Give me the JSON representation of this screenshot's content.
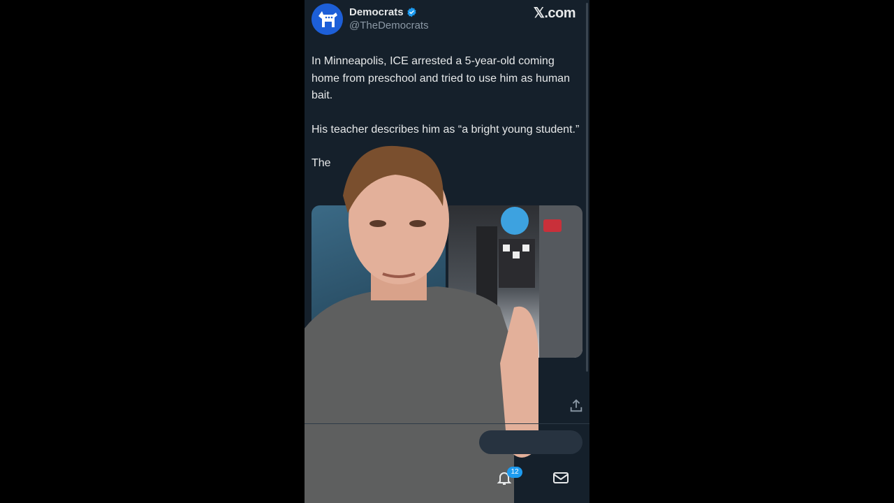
{
  "account": {
    "name": "Democrats",
    "handle": "@TheDemocrats",
    "avatar_icon": "democrat-donkey-icon",
    "verified_icon": "verified-badge-icon",
    "brand_color": "#1d5fd8"
  },
  "site_label": "𝕏.com",
  "tweet": {
    "paragraphs": [
      "In Minneapolis, ICE arrested a 5-year-old coming home from preschool and tried to use him as human bait.",
      "His teacher describes him as “a bright young student.”",
      "The                          ck."
    ]
  },
  "media": {
    "image_count": 2
  },
  "actions": {
    "share_icon": "share-icon"
  },
  "nav": {
    "notifications_icon": "bell-icon",
    "notifications_count": "12",
    "messages_icon": "mail-icon"
  },
  "colors": {
    "background": "#15202b",
    "text": "#e7e9ea",
    "secondary": "#8b98a5",
    "accent": "#1d9bf0"
  }
}
